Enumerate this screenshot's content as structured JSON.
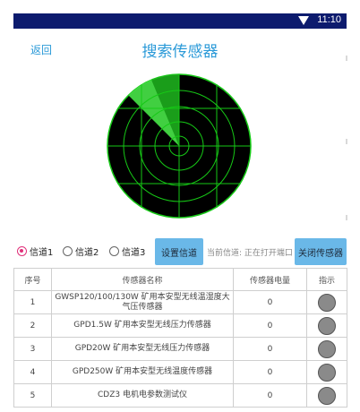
{
  "statusbar": {
    "time": "11:10",
    "wifi_icon": "wifi-icon"
  },
  "header": {
    "back_label": "返回",
    "title": "搜索传感器"
  },
  "radar": {
    "background": "#000000",
    "line_color": "#16c816",
    "sweep_color": "#33dd33"
  },
  "controls": {
    "channels": [
      {
        "label": "信道1",
        "selected": true
      },
      {
        "label": "信道2",
        "selected": false
      },
      {
        "label": "信道3",
        "selected": false
      }
    ],
    "set_channel_button": "设置信道",
    "current_channel_label": "当前信道:",
    "port_status": "正在打开端口",
    "close_sensor_button": "关闭传感器"
  },
  "table": {
    "headers": [
      "序号",
      "传感器名称",
      "传感器电量",
      "指示"
    ],
    "rows": [
      {
        "index": "1",
        "name": "GWSP120/100/130W 矿用本安型无线温湿度大气压传感器",
        "battery": "0"
      },
      {
        "index": "2",
        "name": "GPD1.5W 矿用本安型无线压力传感器",
        "battery": "0"
      },
      {
        "index": "3",
        "name": "GPD20W 矿用本安型无线压力传感器",
        "battery": "0"
      },
      {
        "index": "4",
        "name": "GPD250W 矿用本安型无线温度传感器",
        "battery": "0"
      },
      {
        "index": "5",
        "name": "CDZ3 电机电参数测试仪",
        "battery": "0"
      }
    ]
  }
}
